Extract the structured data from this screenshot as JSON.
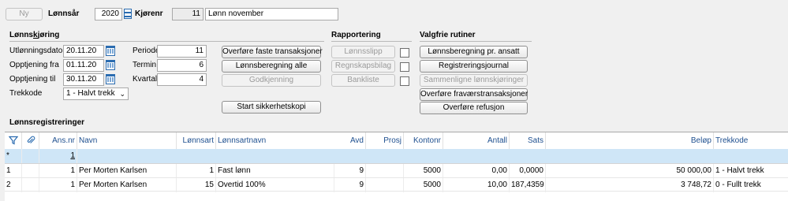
{
  "top": {
    "new_label": "Ny",
    "year_label": "Lønnsår",
    "year_value": "2020",
    "run_label": "Kjørenr",
    "run_number": "11",
    "run_name": "Lønn november"
  },
  "lonnskjoring": {
    "title": "Lønnskjøring",
    "title_mnemonic": "k",
    "utbetalingsdato_label": "Utlønningsdato",
    "utbetalingsdato_value": "20.11.20",
    "opptjening_fra_label": "Opptjening fra",
    "opptjening_fra_value": "01.11.20",
    "opptjening_til_label": "Opptjening til",
    "opptjening_til_value": "30.11.20",
    "trekkode_label": "Trekkode",
    "trekkode_value": "1 - Halvt trekk",
    "periode_label": "Periode",
    "periode_value": "11",
    "termin_label": "Termin",
    "termin_value": "6",
    "kvartal_label": "Kvartal",
    "kvartal_value": "4"
  },
  "actions": {
    "overfore_faste": "Overføre faste transaksjoner",
    "lonnsberegning_alle": "Lønnsberegning alle",
    "godkjenning": "Godkjenning",
    "start_sikkerhetskopi": "Start sikkerhetskopi"
  },
  "rapportering": {
    "title": "Rapportering",
    "lonnsslipp": "Lønnsslipp",
    "regnskapsbilag": "Regnskapsbilag",
    "bankliste": "Bankliste"
  },
  "valgfrie": {
    "title": "Valgfrie rutiner",
    "lonnsberegning_pr_ansatt": "Lønnsberegning pr. ansatt",
    "registreringsjournal": "Registreringsjournal",
    "sammenligne": "Sammenligne lønnskjøringer",
    "overfore_fravaer": "Overføre fraværstransaksjoner",
    "overfore_refusjon": "Overføre refusjon"
  },
  "registreringer": {
    "title": "Lønnsregistreringer",
    "columns": [
      "Ans.nr",
      "Navn",
      "Lønnsart",
      "Lønnsartnavn",
      "Avd",
      "Prosj",
      "Kontonr",
      "Antall",
      "Sats",
      "Beløp",
      "Trekkode"
    ],
    "new_row": {
      "marker": "*",
      "ansnr": "1"
    },
    "rows": [
      {
        "idx": "1",
        "ansnr": "1",
        "navn": "Per Morten Karlsen",
        "lonnsart": "1",
        "lonnsartnavn": "Fast lønn",
        "avd": "9",
        "prosj": "",
        "kontonr": "5000",
        "antall": "0,00",
        "sats": "0,0000",
        "belop": "50 000,00",
        "trekkode": "1 - Halvt trekk"
      },
      {
        "idx": "2",
        "ansnr": "1",
        "navn": "Per Morten Karlsen",
        "lonnsart": "15",
        "lonnsartnavn": "Overtid 100%",
        "avd": "9",
        "prosj": "",
        "kontonr": "5000",
        "antall": "10,00",
        "sats": "187,4359",
        "belop": "3 748,72",
        "trekkode": "0 - Fullt trekk"
      }
    ]
  },
  "colors": {
    "header_text": "#1e4f8f",
    "selected_row": "#cfe6f7",
    "accent": "#2b6cb0"
  }
}
